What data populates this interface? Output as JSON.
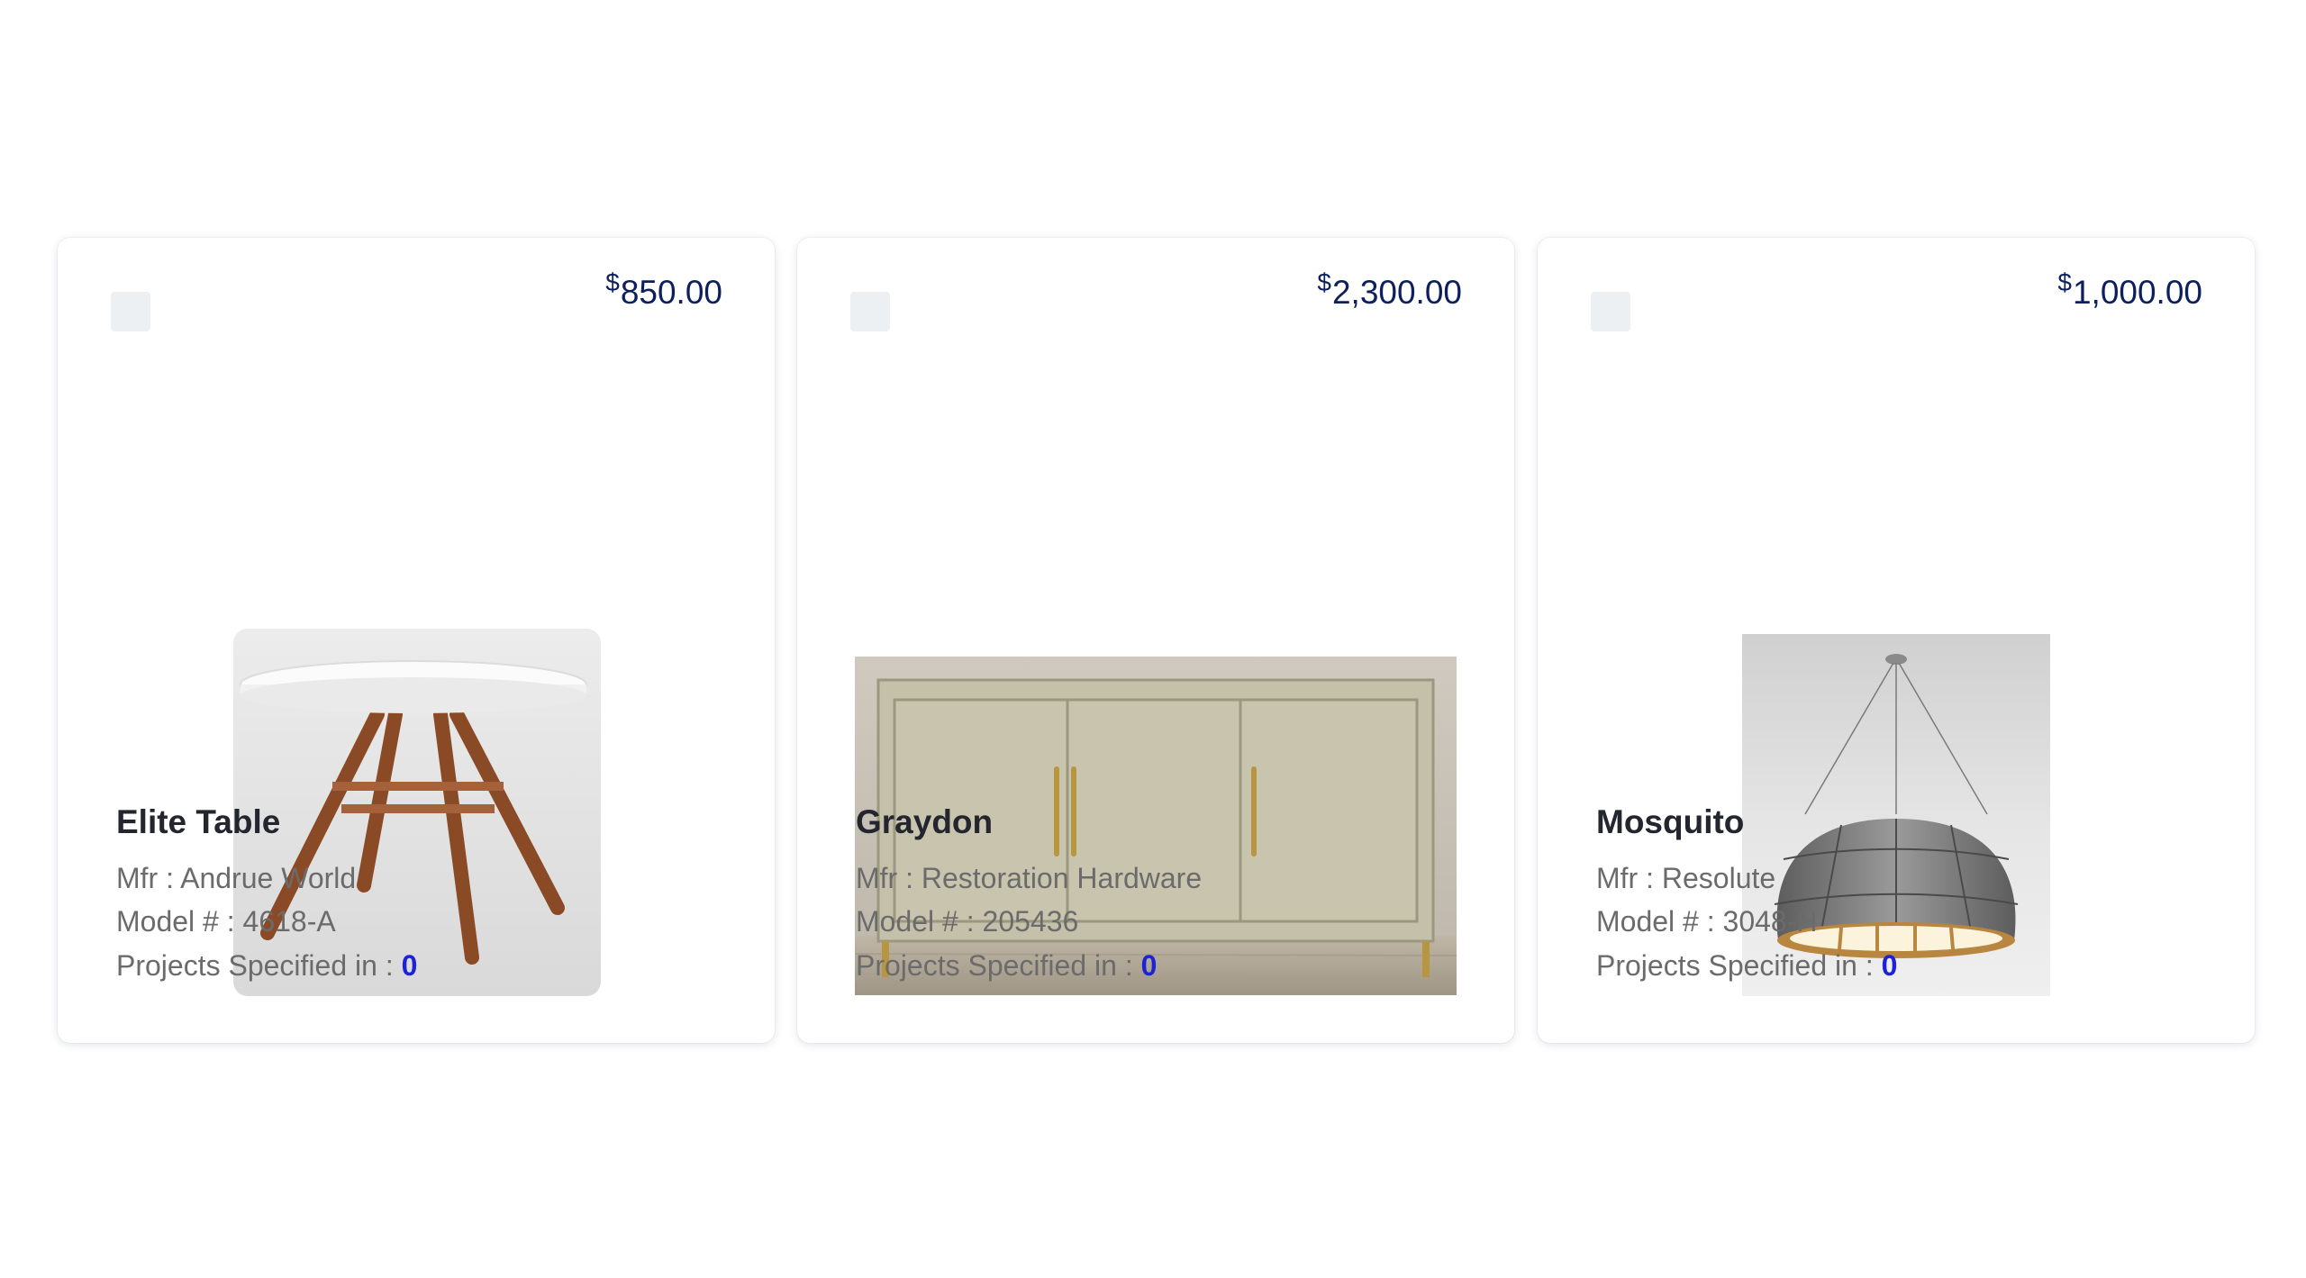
{
  "products": [
    {
      "name": "Elite Table",
      "currency": "$",
      "price": "850.00",
      "mfr_label": "Mfr : ",
      "mfr": "Andrue World",
      "model_label": "Model # : ",
      "model": "4618-A",
      "projects_label": "Projects Specified in : ",
      "projects_count": "0",
      "image_icon": "round-dining-table"
    },
    {
      "name": "Graydon",
      "currency": "$",
      "price": "2,300.00",
      "mfr_label": "Mfr : ",
      "mfr": "Restoration Hardware",
      "model_label": "Model # : ",
      "model": "205436",
      "projects_label": "Projects Specified in : ",
      "projects_count": "0",
      "image_icon": "sideboard-cabinet"
    },
    {
      "name": "Mosquito",
      "currency": "$",
      "price": "1,000.00",
      "mfr_label": "Mfr : ",
      "mfr": "Resolute",
      "model_label": "Model # : ",
      "model": "3048-H",
      "projects_label": "Projects Specified in : ",
      "projects_count": "0",
      "image_icon": "pendant-lamp"
    }
  ],
  "colors": {
    "price": "#0d1f5c",
    "name": "#23262e",
    "meta": "#6b6b6b",
    "count_link": "#1d22d8",
    "checkbox": "#edf0f3"
  }
}
